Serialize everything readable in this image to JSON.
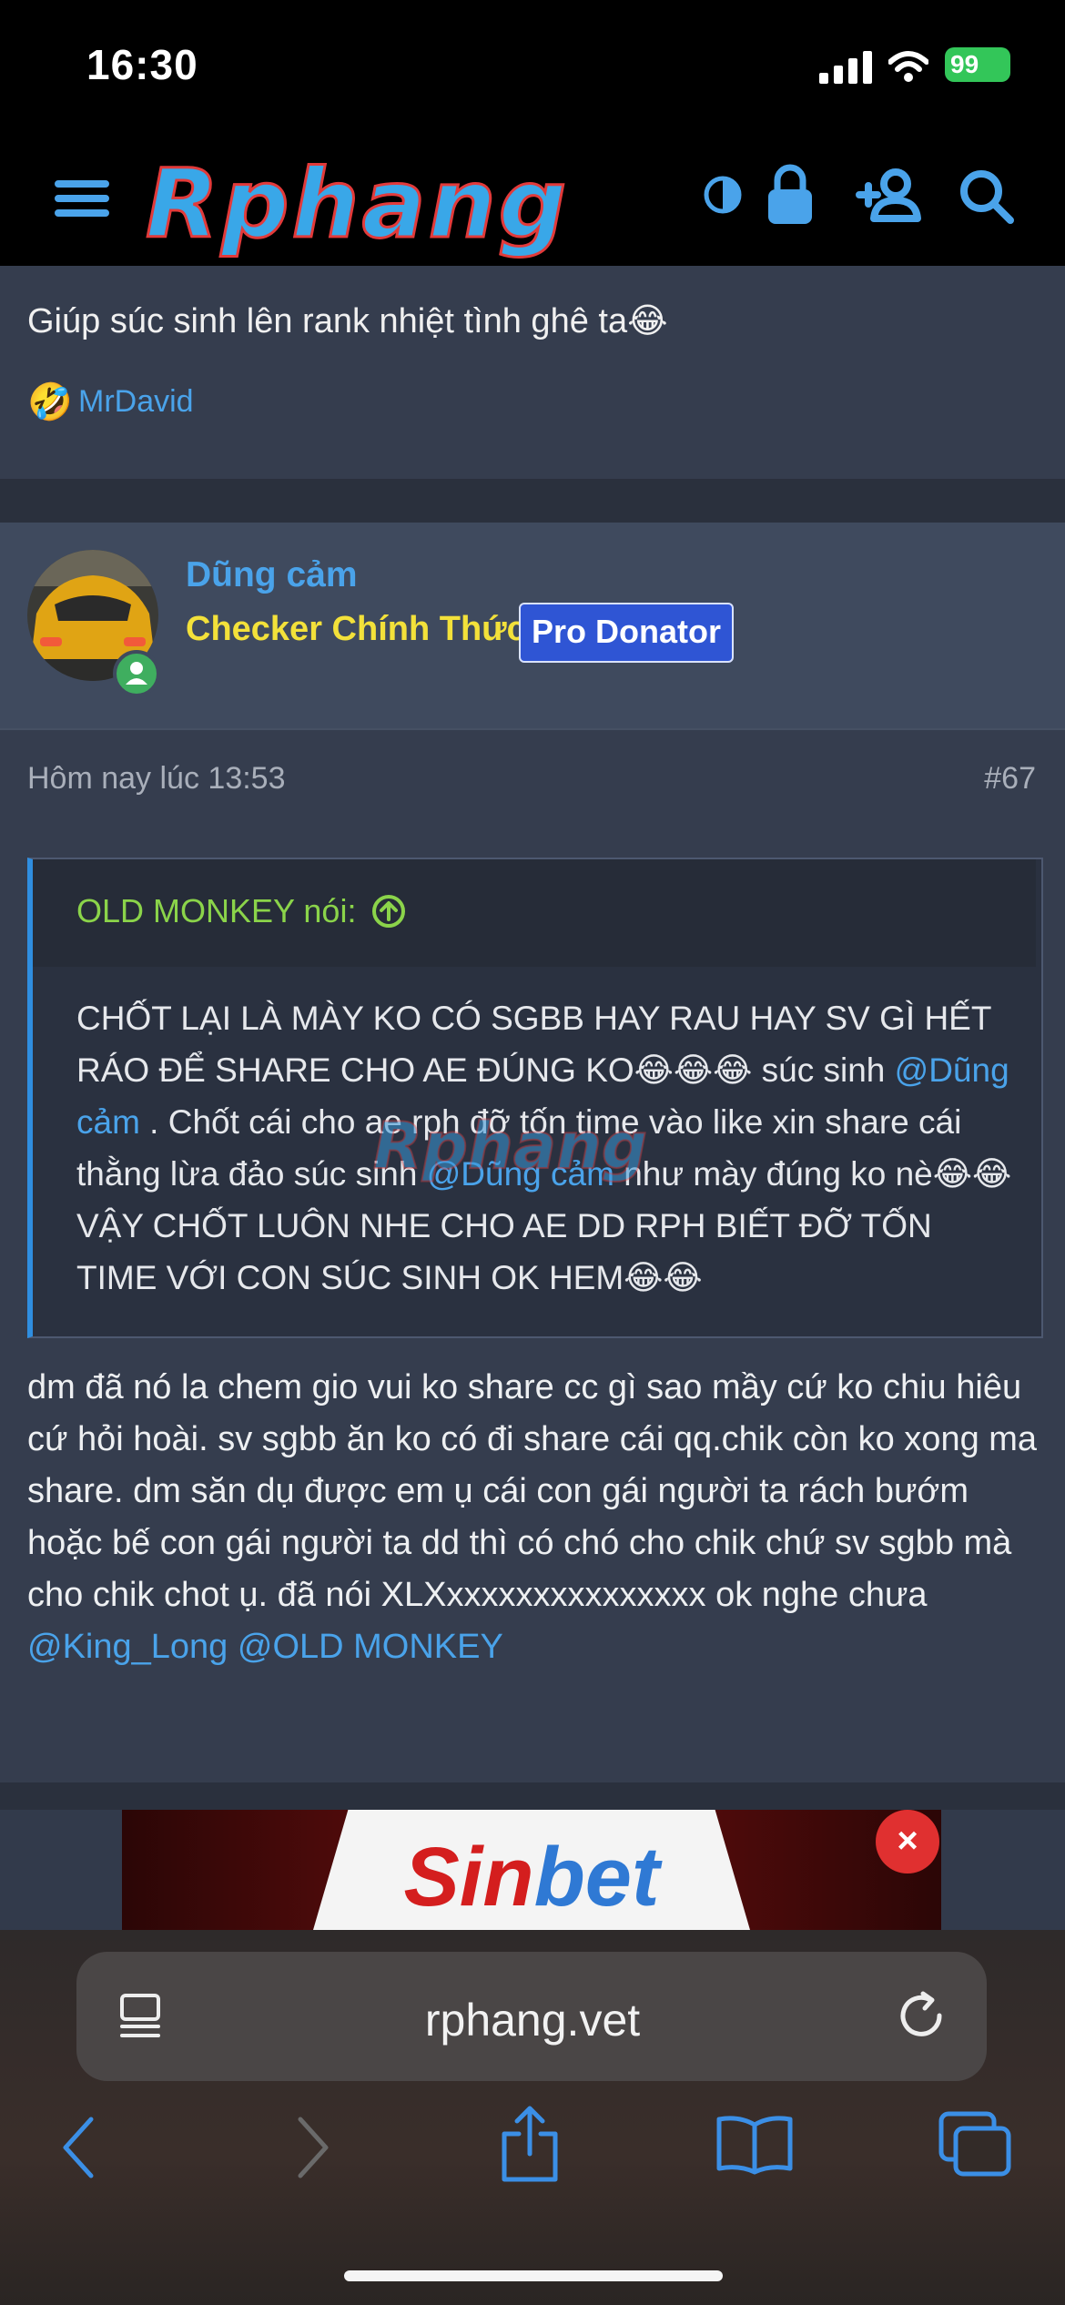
{
  "status_bar": {
    "time": "16:30",
    "battery": "99"
  },
  "header": {
    "logo": "Rphang",
    "icons": [
      "menu-icon",
      "contrast-icon",
      "lock-icon",
      "add-user-icon",
      "search-icon"
    ]
  },
  "post1": {
    "text": "Giúp súc sinh lên rank nhiệt tình ghê ta😂",
    "reaction_emoji": "🤣",
    "reaction_user": "MrDavid"
  },
  "post2": {
    "username": "Dũng cảm",
    "user_title": "Checker Chính Thức",
    "badge": "Pro Donator",
    "date": "Hôm nay lúc 13:53",
    "post_number": "#67",
    "quote": {
      "author": "OLD MONKEY nói:",
      "seg1": "CHỐT LẠI LÀ MÀY KO CÓ SGBB HAY RAU HAY SV GÌ HẾT RÁO ĐỂ SHARE CHO AE ĐÚNG KO😂😂😂 súc sinh ",
      "mention1": "@Dũng cảm",
      "seg2": " . Chốt cái cho ae rph đỡ tốn time vào like xin share cái thằng lừa đảo súc sinh ",
      "mention2": "@Dũng cảm",
      "seg3": " như mày đúng ko nè😂😂 VẬY CHỐT LUÔN NHE CHO AE DD RPH BIẾT ĐỠ TỐN TIME VỚI CON SÚC SINH OK HEM😂😂"
    },
    "body": {
      "text": "dm đã nó la chem gio vui ko share cc gì sao mầy cứ ko chiu hiêu cứ hỏi hoài. sv sgbb ăn ko có đi share cái qq.chik còn ko xong ma share. dm săn dụ được em ụ cái con gái người ta rách bướm hoặc bế con gái người ta dd thì có chó cho chik chứ sv sgbb mà cho chik chot ụ. đã nói XLXxxxxxxxxxxxxxxx ok nghe chưa ",
      "mention1": "@King_Long",
      "mention2": "@OLD MONKEY"
    }
  },
  "ad": {
    "text_sin": "Sin",
    "text_bet": "bet",
    "close": "×"
  },
  "browser": {
    "url": "rphang.vet"
  },
  "colors": {
    "accent": "#4aa3ea",
    "title_yellow": "#f3e13a",
    "quote_author": "#8bd44a",
    "badge": "#2f55d4"
  }
}
